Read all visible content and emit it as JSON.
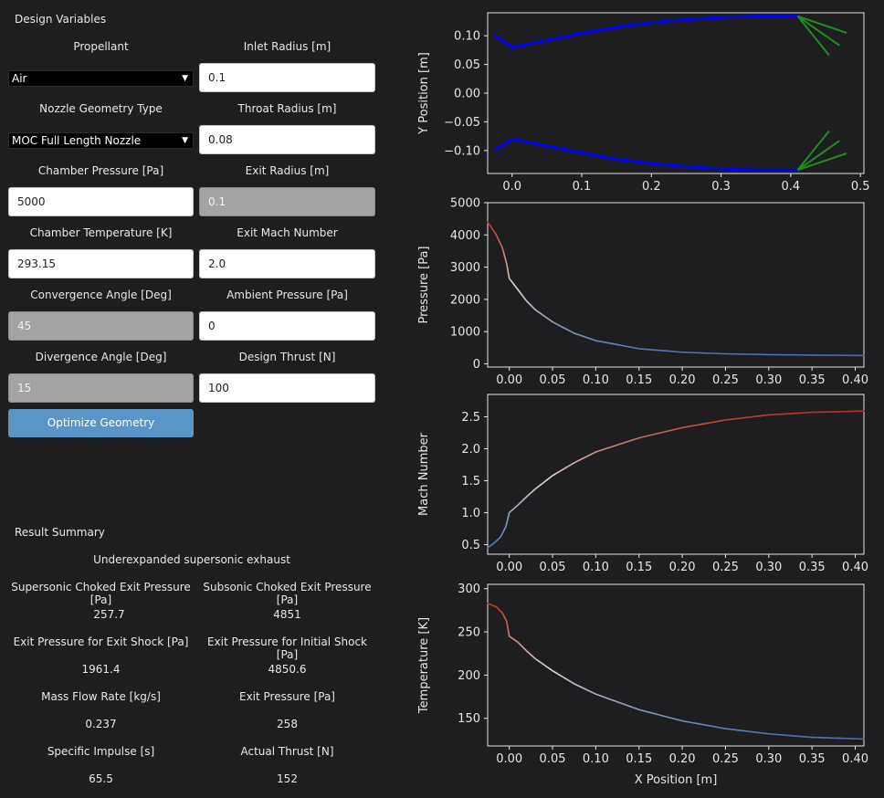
{
  "design": {
    "title": "Design Variables",
    "propellant_label": "Propellant",
    "propellant_value": "Air",
    "inlet_radius_label": "Inlet Radius [m]",
    "inlet_radius_value": "0.1",
    "geometry_label": "Nozzle Geometry Type",
    "geometry_value": "MOC Full Length Nozzle",
    "throat_radius_label": "Throat Radius [m]",
    "throat_radius_value": "0.08",
    "chamber_pressure_label": "Chamber Pressure [Pa]",
    "chamber_pressure_value": "5000",
    "exit_radius_label": "Exit Radius [m]",
    "exit_radius_value": "0.1",
    "chamber_temp_label": "Chamber Temperature [K]",
    "chamber_temp_value": "293.15",
    "exit_mach_label": "Exit Mach Number",
    "exit_mach_value": "2.0",
    "convergence_label": "Convergence Angle [Deg]",
    "convergence_value": "45",
    "ambient_pressure_label": "Ambient Pressure [Pa]",
    "ambient_pressure_value": "0",
    "divergence_label": "Divergence Angle [Deg]",
    "divergence_value": "15",
    "design_thrust_label": "Design Thrust [N]",
    "design_thrust_value": "100",
    "optimize_button": "Optimize Geometry"
  },
  "results": {
    "title": "Result Summary",
    "status": "Underexpanded supersonic exhaust",
    "sup_choked_label": "Supersonic Choked Exit Pressure [Pa]",
    "sup_choked_value": "257.7",
    "sub_choked_label": "Subsonic Choked Exit Pressure [Pa]",
    "sub_choked_value": "4851",
    "exit_shock_label": "Exit Pressure for Exit Shock [Pa]",
    "exit_shock_value": "1961.4",
    "initial_shock_label": "Exit Pressure for Initial Shock [Pa]",
    "initial_shock_value": "4850.6",
    "mass_flow_label": "Mass Flow Rate [kg/s]",
    "mass_flow_value": "0.237",
    "exit_pressure_label": "Exit Pressure [Pa]",
    "exit_pressure_value": "258",
    "isp_label": "Specific Impulse [s]",
    "isp_value": "65.5",
    "thrust_label": "Actual Thrust [N]",
    "thrust_value": "152"
  },
  "colors": {
    "background": "#1e1e21",
    "contour": "#0000ff",
    "characteristics": "#228b22",
    "hot": "#b43024",
    "neutral": "#d9d4c8",
    "cold": "#4a6fb0"
  },
  "chart_data": [
    {
      "type": "line",
      "ylabel": "Y Position [m]",
      "xlim": [
        -0.035,
        0.505
      ],
      "ylim": [
        -0.14,
        0.14
      ],
      "xticks": [
        0.0,
        0.1,
        0.2,
        0.3,
        0.4,
        0.5
      ],
      "xtick_labels": [
        "0.0",
        "0.1",
        "0.2",
        "0.3",
        "0.4",
        "0.5"
      ],
      "yticks": [
        0.1,
        0.05,
        0.0,
        -0.05,
        -0.1
      ],
      "ytick_labels": [
        "0.10",
        "0.05",
        "0.00",
        "−0.05",
        "−0.10"
      ],
      "series": [
        {
          "x": [
            -0.025,
            0.0,
            0.05,
            0.1,
            0.15,
            0.2,
            0.25,
            0.3,
            0.35,
            0.41
          ],
          "y": [
            0.1,
            0.08,
            0.092,
            0.104,
            0.115,
            0.123,
            0.128,
            0.132,
            0.134,
            0.134
          ]
        },
        {
          "x": [
            -0.025,
            0.0,
            0.05,
            0.1,
            0.15,
            0.2,
            0.25,
            0.3,
            0.35,
            0.41
          ],
          "y": [
            -0.1,
            -0.08,
            -0.092,
            -0.104,
            -0.115,
            -0.123,
            -0.128,
            -0.132,
            -0.134,
            -0.134
          ]
        }
      ],
      "characteristic_lines": [
        {
          "x": [
            0.41,
            0.48
          ],
          "y": [
            0.134,
            0.105
          ]
        },
        {
          "x": [
            0.41,
            0.47
          ],
          "y": [
            0.134,
            0.083
          ]
        },
        {
          "x": [
            0.41,
            0.455
          ],
          "y": [
            0.134,
            0.066
          ]
        },
        {
          "x": [
            0.41,
            0.48
          ],
          "y": [
            -0.134,
            -0.105
          ]
        },
        {
          "x": [
            0.41,
            0.47
          ],
          "y": [
            -0.134,
            -0.083
          ]
        },
        {
          "x": [
            0.41,
            0.455
          ],
          "y": [
            -0.134,
            -0.066
          ]
        }
      ]
    },
    {
      "type": "line",
      "ylabel": "Pressure [Pa]",
      "xlim": [
        -0.025,
        0.41
      ],
      "ylim": [
        -100,
        5000
      ],
      "xticks": [
        0.0,
        0.05,
        0.1,
        0.15,
        0.2,
        0.25,
        0.3,
        0.35,
        0.4
      ],
      "xtick_labels": [
        "0.00",
        "0.05",
        "0.10",
        "0.15",
        "0.20",
        "0.25",
        "0.30",
        "0.35",
        "0.40"
      ],
      "yticks": [
        0,
        1000,
        2000,
        3000,
        4000,
        5000
      ],
      "ytick_labels": [
        "0",
        "1000",
        "2000",
        "3000",
        "4000",
        "5000"
      ],
      "x": [
        -0.025,
        -0.015,
        -0.008,
        -0.003,
        0.0,
        0.01,
        0.02,
        0.03,
        0.05,
        0.075,
        0.1,
        0.15,
        0.2,
        0.25,
        0.3,
        0.35,
        0.41
      ],
      "y": [
        4400,
        4000,
        3600,
        3100,
        2650,
        2300,
        1950,
        1680,
        1300,
        950,
        720,
        470,
        360,
        310,
        285,
        270,
        258
      ],
      "color_by": "temperature"
    },
    {
      "type": "line",
      "ylabel": "Mach Number",
      "xlim": [
        -0.025,
        0.41
      ],
      "ylim": [
        0.35,
        2.85
      ],
      "xticks": [
        0.0,
        0.05,
        0.1,
        0.15,
        0.2,
        0.25,
        0.3,
        0.35,
        0.4
      ],
      "xtick_labels": [
        "0.00",
        "0.05",
        "0.10",
        "0.15",
        "0.20",
        "0.25",
        "0.30",
        "0.35",
        "0.40"
      ],
      "yticks": [
        0.5,
        1.0,
        1.5,
        2.0,
        2.5
      ],
      "ytick_labels": [
        "0.5",
        "1.0",
        "1.5",
        "2.0",
        "2.5"
      ],
      "x": [
        -0.025,
        -0.018,
        -0.01,
        -0.004,
        0.0,
        0.01,
        0.02,
        0.03,
        0.05,
        0.075,
        0.1,
        0.15,
        0.2,
        0.25,
        0.3,
        0.35,
        0.41
      ],
      "y": [
        0.45,
        0.52,
        0.62,
        0.78,
        1.0,
        1.12,
        1.25,
        1.37,
        1.58,
        1.78,
        1.95,
        2.17,
        2.33,
        2.45,
        2.53,
        2.57,
        2.59
      ],
      "color_by": "mach"
    },
    {
      "type": "line",
      "ylabel": "Temperature [K]",
      "xlabel": "X Position [m]",
      "xlim": [
        -0.025,
        0.41
      ],
      "ylim": [
        118,
        305
      ],
      "xticks": [
        0.0,
        0.05,
        0.1,
        0.15,
        0.2,
        0.25,
        0.3,
        0.35,
        0.4
      ],
      "xtick_labels": [
        "0.00",
        "0.05",
        "0.10",
        "0.15",
        "0.20",
        "0.25",
        "0.30",
        "0.35",
        "0.40"
      ],
      "yticks": [
        150,
        200,
        250,
        300
      ],
      "ytick_labels": [
        "150",
        "200",
        "250",
        "300"
      ],
      "x": [
        -0.025,
        -0.015,
        -0.008,
        -0.003,
        0.0,
        0.01,
        0.02,
        0.03,
        0.05,
        0.075,
        0.1,
        0.15,
        0.2,
        0.25,
        0.3,
        0.35,
        0.41
      ],
      "y": [
        283,
        279,
        272,
        262,
        245,
        238,
        228,
        219,
        205,
        190,
        178,
        160,
        147,
        138,
        132,
        128,
        126
      ],
      "color_by": "temperature"
    }
  ]
}
